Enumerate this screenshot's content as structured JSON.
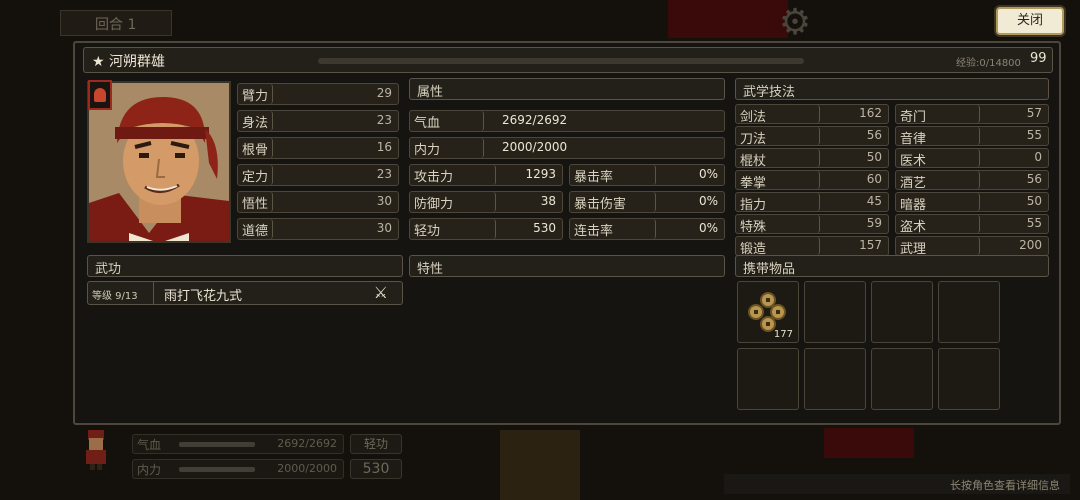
{
  "top": {
    "round_label": "回合 1",
    "close_label": "关闭"
  },
  "panel": {
    "title": "★ 河朔群雄",
    "exp_label": "经验:0/14800",
    "level": "99"
  },
  "attributes": [
    {
      "label": "臂力",
      "value": "29"
    },
    {
      "label": "身法",
      "value": "23"
    },
    {
      "label": "根骨",
      "value": "16"
    },
    {
      "label": "定力",
      "value": "23"
    },
    {
      "label": "悟性",
      "value": "30"
    },
    {
      "label": "道德",
      "value": "30"
    }
  ],
  "properties": {
    "header": "属性",
    "hp": {
      "label": "气血",
      "value": "2692/2692"
    },
    "mp": {
      "label": "内力",
      "value": "2000/2000"
    },
    "attack": {
      "label": "攻击力",
      "value": "1293"
    },
    "defense": {
      "label": "防御力",
      "value": "38"
    },
    "agility": {
      "label": "轻功",
      "value": "530"
    },
    "crit_rate": {
      "label": "暴击率",
      "value": "0%"
    },
    "crit_dmg": {
      "label": "暴击伤害",
      "value": "0%"
    },
    "combo_rate": {
      "label": "连击率",
      "value": "0%"
    }
  },
  "techniques": {
    "header": "武学技法",
    "left": [
      {
        "label": "剑法",
        "value": "162"
      },
      {
        "label": "刀法",
        "value": "56"
      },
      {
        "label": "棍杖",
        "value": "50"
      },
      {
        "label": "拳掌",
        "value": "60"
      },
      {
        "label": "指力",
        "value": "45"
      },
      {
        "label": "特殊",
        "value": "59"
      },
      {
        "label": "锻造",
        "value": "157"
      }
    ],
    "right": [
      {
        "label": "奇门",
        "value": "57"
      },
      {
        "label": "音律",
        "value": "55"
      },
      {
        "label": "医术",
        "value": "0"
      },
      {
        "label": "酒艺",
        "value": "56"
      },
      {
        "label": "暗器",
        "value": "50"
      },
      {
        "label": "盗术",
        "value": "55"
      },
      {
        "label": "武理",
        "value": "200"
      }
    ]
  },
  "martial": {
    "header": "武功",
    "skill_level": "等级 9/13",
    "skill_name": "雨打飞花九式"
  },
  "traits": {
    "header": "特性"
  },
  "inventory": {
    "header": "携带物品",
    "first_item_count": "177"
  },
  "hud": {
    "hp_label": "气血",
    "hp_value": "2692/2692",
    "mp_label": "内力",
    "mp_value": "2000/2000",
    "agility_label": "轻功",
    "agility_value": "530"
  },
  "hint": "长按角色查看详细信息"
}
